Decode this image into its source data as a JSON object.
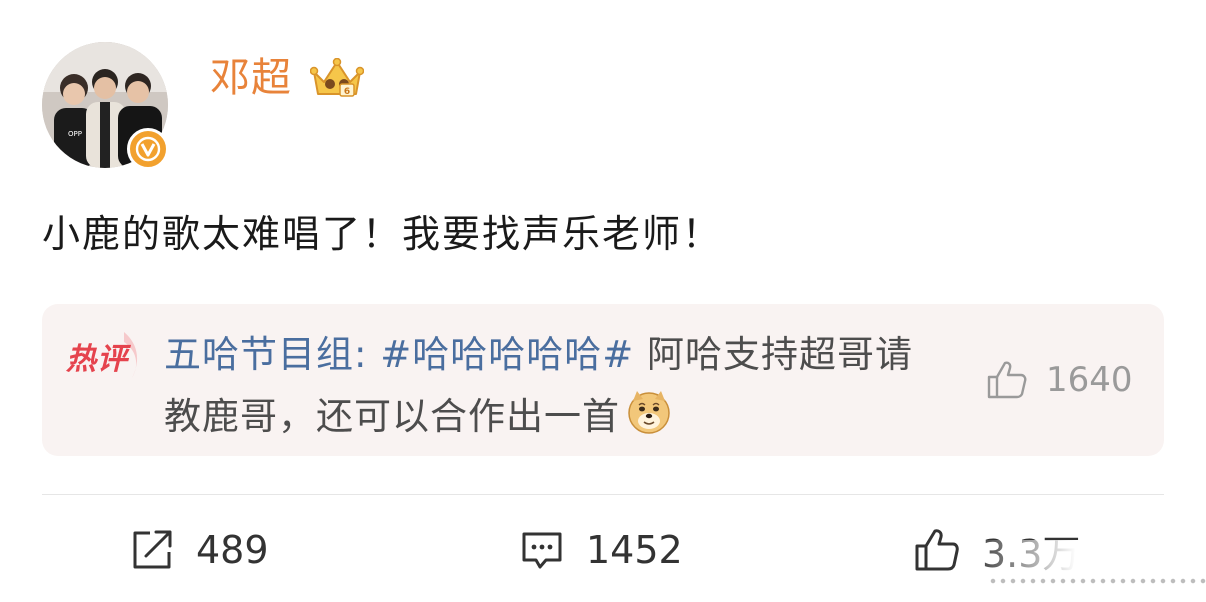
{
  "user": {
    "name": "邓超",
    "verified_color": "#f2a12e",
    "name_color": "#e8833a"
  },
  "post": {
    "text": "小鹿的歌太难唱了！我要找声乐老师！"
  },
  "hot_comment": {
    "badge": "热评",
    "commenter": "五哈节目组:",
    "hashtag": "#哈哈哈哈哈#",
    "text": " 阿哈支持超哥请教鹿哥，还可以合作出一首",
    "emoji": "doge-emoji",
    "likes": "1640"
  },
  "actions": {
    "share_count": "489",
    "comment_count": "1452",
    "like_count": "3.3万"
  },
  "colors": {
    "link": "#4a6e9f",
    "hot_badge": "#e5434d",
    "comment_bg": "#f9f3f2"
  }
}
